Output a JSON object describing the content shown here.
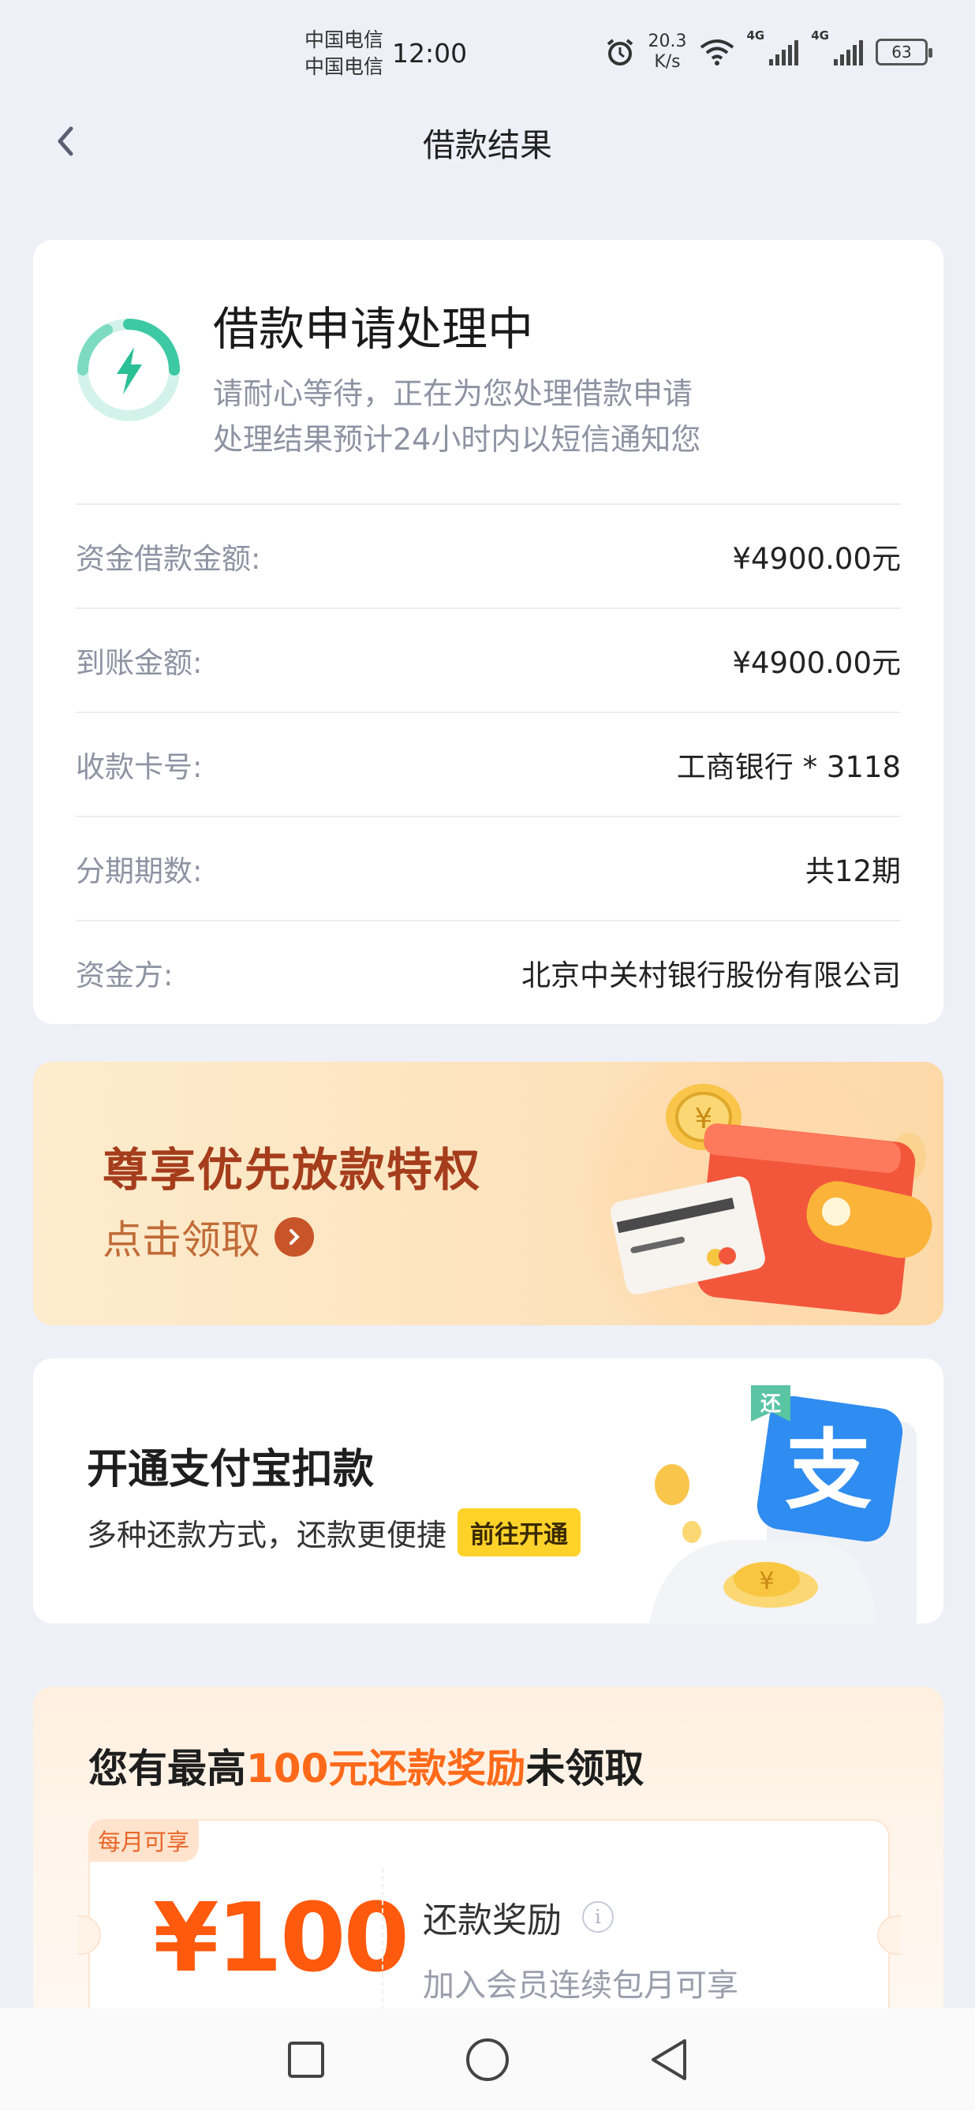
{
  "status_bar": {
    "carrier1": "中国电信",
    "carrier2": "中国电信",
    "time": "12:00",
    "speed_value": "20.3",
    "speed_unit": "K/s",
    "net1": "4G",
    "net2": "4G",
    "battery": "63"
  },
  "nav": {
    "title": "借款结果"
  },
  "result": {
    "title": "借款申请处理中",
    "desc1": "请耐心等待，正在为您处理借款申请",
    "desc2": "处理结果预计24小时内以短信通知您",
    "rows": [
      {
        "key": "资金借款金额:",
        "value": "¥4900.00元"
      },
      {
        "key": "到账金额:",
        "value": "¥4900.00元"
      },
      {
        "key": "收款卡号:",
        "value": "工商银行 * 3118"
      },
      {
        "key": "分期期数:",
        "value": "共12期"
      },
      {
        "key": "资金方:",
        "value": "北京中关村银行股份有限公司"
      }
    ]
  },
  "banner_priority": {
    "title": "尊享优先放款特权",
    "cta": "点击领取"
  },
  "banner_alipay": {
    "title": "开通支付宝扣款",
    "subtitle": "多种还款方式，还款更便捷",
    "button": "前往开通",
    "logo_char": "支",
    "tag_char": "还"
  },
  "reward": {
    "title_pre": "您有最高",
    "title_highlight": "100元还款奖励",
    "title_post": "未领取",
    "tag": "每月可享",
    "amount": "¥100",
    "name": "还款奖励",
    "desc": "加入会员连续包月可享"
  },
  "colors": {
    "accent_green": "#3cc9a3",
    "reward_orange": "#ff6a1a",
    "banner_red": "#a53d1c",
    "alipay_blue": "#2f8cf0",
    "button_yellow": "#ffd22a"
  }
}
